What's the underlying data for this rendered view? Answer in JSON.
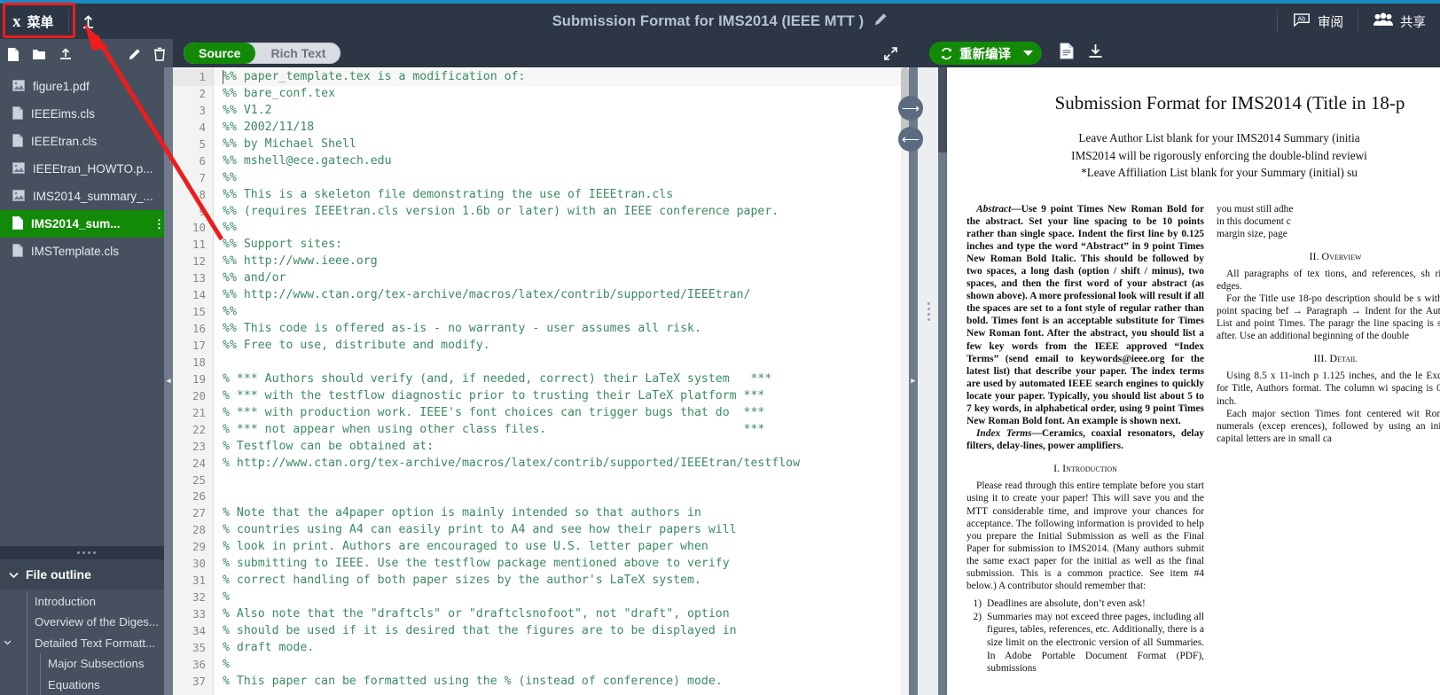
{
  "header": {
    "menu_label": "菜单",
    "menu_icon": "leaf-logo-icon",
    "upload_icon": "upload-icon",
    "title": "Submission Format for IMS2014 (IEEE MTT )",
    "rename_icon": "pencil-icon",
    "review_label": "审阅",
    "review_icon": "review-ab-icon",
    "share_label": "共享",
    "share_icon": "users-icon"
  },
  "sidebar": {
    "toolbar": [
      {
        "name": "new-file-icon",
        "label": "new file"
      },
      {
        "name": "new-folder-icon",
        "label": "new folder"
      },
      {
        "name": "upload-file-icon",
        "label": "upload"
      },
      {
        "name": "rename-icon",
        "label": "rename"
      },
      {
        "name": "delete-icon",
        "label": "delete"
      }
    ],
    "files": [
      {
        "name": "figure1.pdf",
        "type": "image",
        "selected": false
      },
      {
        "name": "IEEEims.cls",
        "type": "file",
        "selected": false
      },
      {
        "name": "IEEEtran.cls",
        "type": "file",
        "selected": false
      },
      {
        "name": "IEEEtran_HOWTO.p...",
        "type": "image",
        "selected": false
      },
      {
        "name": "IMS2014_summary_...",
        "type": "image",
        "selected": false
      },
      {
        "name": "IMS2014_sum...",
        "type": "file",
        "selected": true
      },
      {
        "name": "IMSTemplate.cls",
        "type": "file",
        "selected": false
      }
    ],
    "outline_title": "File outline",
    "outline": [
      {
        "label": "Introduction",
        "level": 1,
        "expandable": false
      },
      {
        "label": "Overview of the Diges...",
        "level": 1,
        "expandable": false
      },
      {
        "label": "Detailed Text Formatt...",
        "level": 1,
        "expandable": true
      },
      {
        "label": "Major Subsections",
        "level": 2,
        "expandable": false
      },
      {
        "label": "Equations",
        "level": 2,
        "expandable": false
      }
    ]
  },
  "editor": {
    "mode_source": "Source",
    "mode_rich": "Rich Text",
    "active_mode": "Source",
    "expand_icon": "expand-arrows-icon",
    "lines": [
      {
        "n": 1,
        "t": "%% paper_template.tex is a modification of:"
      },
      {
        "n": 2,
        "t": "%% bare_conf.tex"
      },
      {
        "n": 3,
        "t": "%% V1.2"
      },
      {
        "n": 4,
        "t": "%% 2002/11/18"
      },
      {
        "n": 5,
        "t": "%% by Michael Shell"
      },
      {
        "n": 6,
        "t": "%% mshell@ece.gatech.edu"
      },
      {
        "n": 7,
        "t": "%%"
      },
      {
        "n": 8,
        "t": "%% This is a skeleton file demonstrating the use of IEEEtran.cls"
      },
      {
        "n": 9,
        "t": "%% (requires IEEEtran.cls version 1.6b or later) with an IEEE conference paper."
      },
      {
        "n": 10,
        "t": "%%"
      },
      {
        "n": 11,
        "t": "%% Support sites:"
      },
      {
        "n": 12,
        "t": "%% http://www.ieee.org"
      },
      {
        "n": 13,
        "t": "%% and/or"
      },
      {
        "n": 14,
        "t": "%% http://www.ctan.org/tex-archive/macros/latex/contrib/supported/IEEEtran/"
      },
      {
        "n": 15,
        "t": "%%"
      },
      {
        "n": 16,
        "t": "%% This code is offered as-is - no warranty - user assumes all risk."
      },
      {
        "n": 17,
        "t": "%% Free to use, distribute and modify."
      },
      {
        "n": 18,
        "t": ""
      },
      {
        "n": 19,
        "t": "% *** Authors should verify (and, if needed, correct) their LaTeX system   ***"
      },
      {
        "n": 20,
        "t": "% *** with the testflow diagnostic prior to trusting their LaTeX platform ***"
      },
      {
        "n": 21,
        "t": "% *** with production work. IEEE's font choices can trigger bugs that do  ***"
      },
      {
        "n": 22,
        "t": "% *** not appear when using other class files.                            ***"
      },
      {
        "n": 23,
        "t": "% Testflow can be obtained at:"
      },
      {
        "n": 24,
        "t": "% http://www.ctan.org/tex-archive/macros/latex/contrib/supported/IEEEtran/testflow"
      },
      {
        "n": 25,
        "t": ""
      },
      {
        "n": 26,
        "t": ""
      },
      {
        "n": 27,
        "t": "% Note that the a4paper option is mainly intended so that authors in"
      },
      {
        "n": 28,
        "t": "% countries using A4 can easily print to A4 and see how their papers will"
      },
      {
        "n": 29,
        "t": "% look in print. Authors are encouraged to use U.S. letter paper when"
      },
      {
        "n": 30,
        "t": "% submitting to IEEE. Use the testflow package mentioned above to verify"
      },
      {
        "n": 31,
        "t": "% correct handling of both paper sizes by the author's LaTeX system."
      },
      {
        "n": 32,
        "t": "%"
      },
      {
        "n": 33,
        "t": "% Also note that the \"draftcls\" or \"draftclsnofoot\", not \"draft\", option"
      },
      {
        "n": 34,
        "t": "% should be used if it is desired that the figures are to be displayed in"
      },
      {
        "n": 35,
        "t": "% draft mode."
      },
      {
        "n": 36,
        "t": "%"
      },
      {
        "n": 37,
        "t": "% This paper can be formatted using the % (instead of conference) mode."
      }
    ]
  },
  "preview": {
    "recompile_label": "重新编译",
    "recompile_icon": "refresh-icon",
    "dropdown_icon": "caret-down-icon",
    "logs_icon": "file-text-icon",
    "download_icon": "download-icon",
    "prev_icon": "arrow-right-circle-icon",
    "next_icon": "arrow-left-circle-icon",
    "pdf": {
      "title": "Submission Format for IMS2014 (Title in 18-p",
      "authors": [
        "Leave Author List blank for your IMS2014 Summary (initia",
        "IMS2014 will be rigorously enforcing the double-blind reviewi",
        "*Leave Affiliation List blank for your Summary (initial) su"
      ],
      "abstract_label": "Abstract",
      "abstract": "—Use 9 point Times New Roman Bold for the abstract. Set your line spacing to be 10 points rather than single space. Indent the first line by 0.125 inches and type the word “Abstract” in 9 point Times New Roman Bold Italic. This should be followed by two spaces, a long dash (option / shift / minus), two spaces, and then the first word of your abstract (as shown above). A more professional look will result if all the spaces are set to a font style of regular rather than bold. Times font is an acceptable substitute for Times New Roman font. After the abstract, you should list a few key words from the IEEE approved “Index Terms” (send email to keywords@ieee.org for the latest list) that describe your paper. The index terms are used by automated IEEE search engines to quickly locate your paper. Typically, you should list about 5 to 7 key words, in alphabetical order, using 9 point Times New Roman Bold font. An example is shown next.",
      "index_label": "Index Terms",
      "index_terms": "—Ceramics, coaxial resonators, delay filters, delay-lines, power amplifiers.",
      "section1": "I.  Introduction",
      "intro": "Please read through this entire template before you start using it to create your paper! This will save you and the MTT considerable time, and improve your chances for acceptance. The following information is provided to help you prepare the Initial Submission as well as the Final Paper for submission to IMS2014. (Many authors submit the same exact paper for the initial as well as the final submission. This is a common practice. See item #4 below.) A contributor should remember that:",
      "list": [
        {
          "num": "1)",
          "text": "Deadlines are absolute, don’t even ask!"
        },
        {
          "num": "2)",
          "text": "Summaries may not exceed three pages, including all figures, tables, references, etc. Additionally, there is a size limit on the electronic version of all Summaries. In Adobe Portable Document Format (PDF), submissions"
        }
      ],
      "col2_top": "you must still adhe\nin this document c\nmargin size, page",
      "section2": "II.  Overview",
      "overview1": "All paragraphs of tex tions, and references, sh right edges.",
      "overview2": "For the Title use 18-po description should be s with 6-point spacing bef → Paragraph → Indent for the Author List and point Times. The paragr the line spacing is sing after. Use an additional beginning of the double",
      "section3": "III.  Detail",
      "detail1": "Using 8.5 x 11-inch p 1.125 inches, and the le Except for Title, Authors format. The column wi spacing is 0.25 inch.",
      "detail2": "Each major section Times font centered wit Roman numerals (excep erences), followed by using an initial capital letters are in small ca"
    }
  },
  "annotations": {
    "highlight_box": "menu-button-highlight",
    "arrow": "red-pointer-arrow"
  }
}
